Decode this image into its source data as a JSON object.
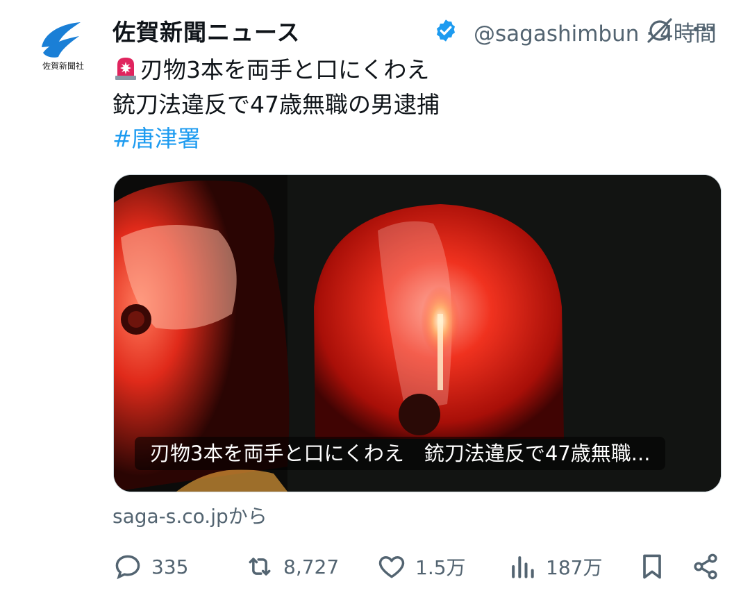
{
  "account": {
    "display_name": "佐賀新聞ニュース",
    "handle": "@sagashimbun",
    "time": "· 4時間",
    "avatar_text": "佐賀新聞社",
    "verified": true
  },
  "tweet": {
    "line1": "刃物3本を両手と口にくわえ",
    "line2": "銃刀法違反で47歳無職の男逮捕",
    "hashtag": "#唐津署",
    "emoji": "police-siren-icon"
  },
  "card": {
    "title": "刃物3本を両手と口にくわえ　銃刀法違反で47歳無職...",
    "source": "saga-s.co.jpから"
  },
  "actions": {
    "replies": "335",
    "reposts": "8,727",
    "likes": "1.5万",
    "views": "187万"
  },
  "colors": {
    "accent": "#1d9bf0",
    "muted": "#536471",
    "text": "#0f1419"
  }
}
